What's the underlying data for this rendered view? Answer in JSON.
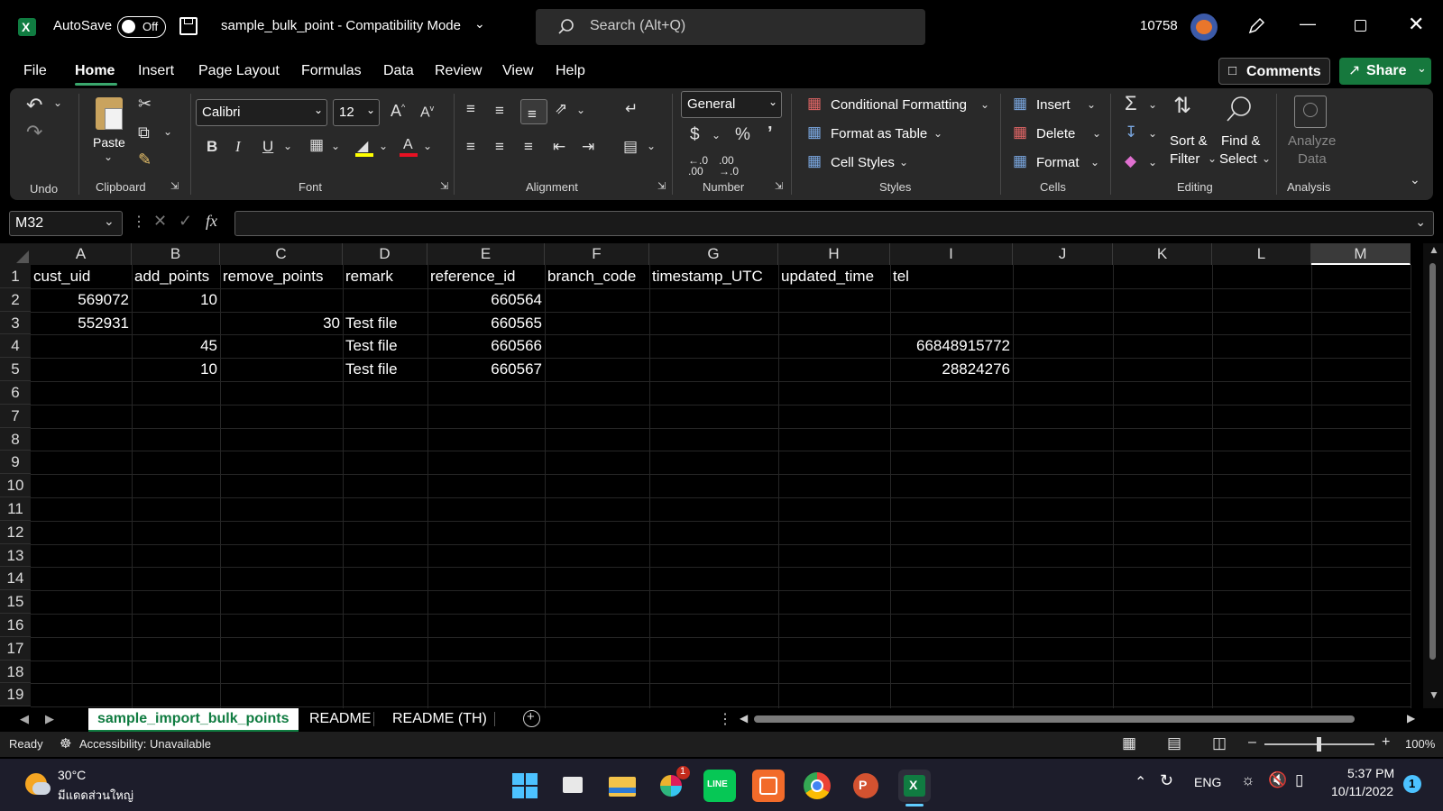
{
  "titlebar": {
    "autosave_label": "AutoSave",
    "autosave_state": "Off",
    "file_title": "sample_bulk_point  -  Compatibility Mode",
    "search_placeholder": "Search (Alt+Q)",
    "user_id": "10758"
  },
  "menu": {
    "items": [
      "File",
      "Home",
      "Insert",
      "Page Layout",
      "Formulas",
      "Data",
      "Review",
      "View",
      "Help"
    ],
    "active": "Home",
    "comments_label": "Comments",
    "share_label": "Share"
  },
  "ribbon": {
    "groups": {
      "undo": "Undo",
      "clipboard": "Clipboard",
      "font": "Font",
      "alignment": "Alignment",
      "number": "Number",
      "styles": "Styles",
      "cells": "Cells",
      "editing": "Editing",
      "analysis": "Analysis"
    },
    "paste_label": "Paste",
    "font_name": "Calibri",
    "font_size": "12",
    "number_format": "General",
    "conditional_formatting": "Conditional Formatting",
    "format_as_table": "Format as Table",
    "cell_styles": "Cell Styles",
    "insert": "Insert",
    "delete": "Delete",
    "format": "Format",
    "sort_filter_1": "Sort &",
    "sort_filter_2": "Filter",
    "find_select_1": "Find &",
    "find_select_2": "Select",
    "analyze_1": "Analyze",
    "analyze_2": "Data"
  },
  "formula_bar": {
    "name_box": "M32",
    "fx": "fx",
    "value": ""
  },
  "sheet": {
    "columns": [
      "A",
      "B",
      "C",
      "D",
      "E",
      "F",
      "G",
      "H",
      "I",
      "J",
      "K",
      "L",
      "M"
    ],
    "selected_column": "M",
    "row_numbers": [
      "1",
      "2",
      "3",
      "4",
      "5",
      "6",
      "7",
      "8",
      "9",
      "10",
      "11",
      "12",
      "13",
      "14",
      "15",
      "16",
      "17",
      "18",
      "19"
    ],
    "rows": [
      [
        "cust_uid",
        "add_points",
        "remove_points",
        "remark",
        "reference_id",
        "branch_code",
        "timestamp_UTC",
        "updated_time",
        "tel",
        "",
        "",
        "",
        ""
      ],
      [
        "569072",
        "10",
        "",
        "",
        "660564",
        "",
        "",
        "",
        "",
        "",
        "",
        "",
        ""
      ],
      [
        "552931",
        "",
        "30",
        "Test file",
        "660565",
        "",
        "",
        "",
        "",
        "",
        "",
        "",
        ""
      ],
      [
        "",
        "45",
        "",
        "Test file",
        "660566",
        "",
        "",
        "",
        "66848915772",
        "",
        "",
        "",
        ""
      ],
      [
        "",
        "10",
        "",
        "Test file",
        "660567",
        "",
        "",
        "",
        "28824276",
        "",
        "",
        "",
        ""
      ]
    ]
  },
  "tabs": [
    "sample_import_bulk_points",
    "README",
    "README (TH)"
  ],
  "active_tab": "sample_import_bulk_points",
  "status": {
    "ready": "Ready",
    "accessibility": "Accessibility: Unavailable",
    "zoom": "100%"
  },
  "taskbar": {
    "temperature": "30°C",
    "weather": "มีแดดส่วนใหญ่",
    "language": "ENG",
    "time": "5:37 PM",
    "date": "10/11/2022",
    "notification_count": "1",
    "slack_badge": "1"
  }
}
